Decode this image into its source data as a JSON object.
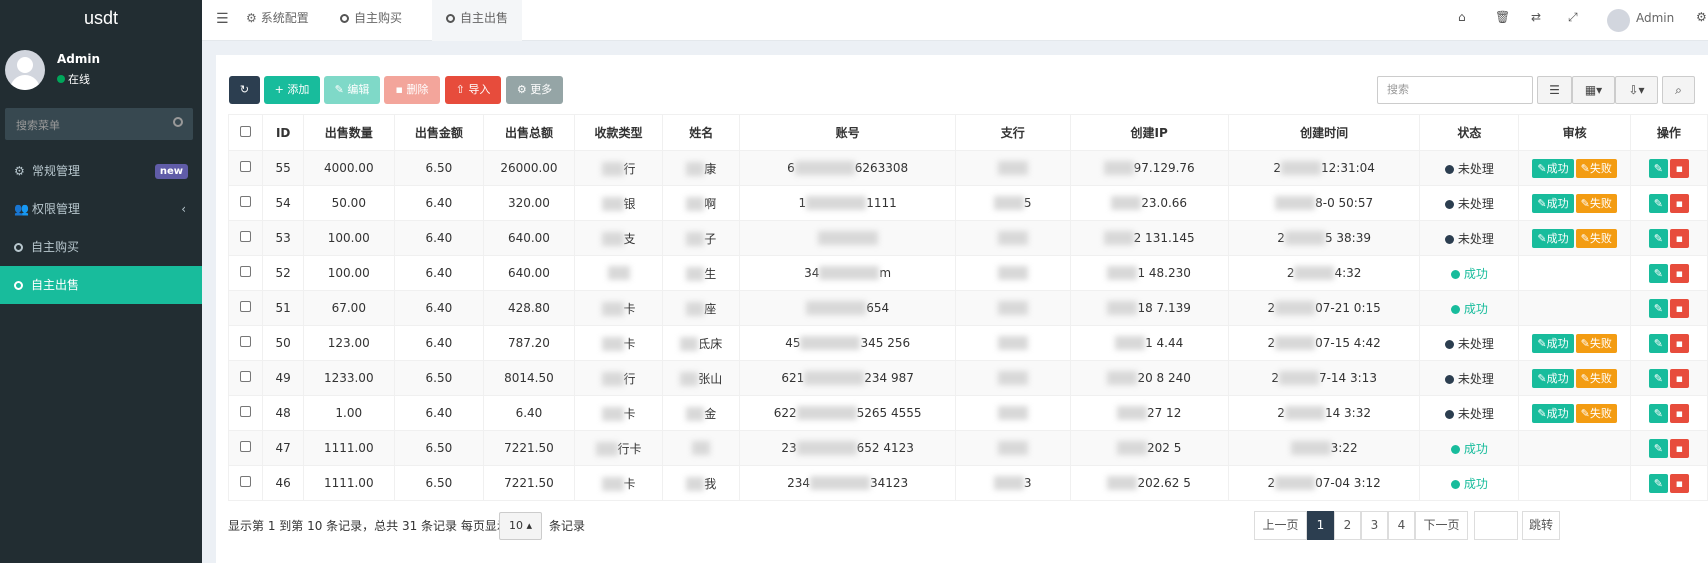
{
  "app": {
    "logo": "usdt"
  },
  "user": {
    "name": "Admin",
    "status": "在线"
  },
  "sidebar": {
    "search_placeholder": "搜索菜单",
    "items": [
      {
        "label": "常规管理",
        "icon": "cogs-icon",
        "badge": "new"
      },
      {
        "label": "权限管理",
        "icon": "group-icon",
        "arrow": "‹"
      },
      {
        "label": "自主购买",
        "icon": "circle-icon"
      },
      {
        "label": "自主出售",
        "icon": "circle-icon",
        "active": true
      }
    ]
  },
  "header": {
    "tabs": [
      {
        "label": "系统配置",
        "icon": "gear-icon"
      },
      {
        "label": "自主购买",
        "icon": "circle-icon"
      },
      {
        "label": "自主出售",
        "icon": "circle-icon",
        "active": true
      }
    ],
    "user": "Admin"
  },
  "toolbar": {
    "add": "添加",
    "edit": "编辑",
    "delete": "删除",
    "import": "导入",
    "more": "更多",
    "search_placeholder": "搜索"
  },
  "table": {
    "columns": [
      "ID",
      "出售数量",
      "出售金额",
      "出售总额",
      "收款类型",
      "姓名",
      "账号",
      "支行",
      "创建IP",
      "创建时间",
      "状态",
      "审核",
      "操作"
    ],
    "rows": [
      {
        "id": "55",
        "qty": "4000.00",
        "price": "6.50",
        "total": "26000.00",
        "type": "行",
        "name": "康",
        "account": "6",
        "account2": "6263308",
        "branch": "",
        "ip": "97.129.76",
        "time_a": "2",
        "time_b": "12:31:04",
        "status": "未处理",
        "pending": true
      },
      {
        "id": "54",
        "qty": "50.00",
        "price": "6.40",
        "total": "320.00",
        "type": "银",
        "name": "啊",
        "account": "1",
        "account2": "1111",
        "branch": "5",
        "ip": "23.0.66",
        "time_a": "",
        "time_b": "8-0  50:57",
        "status": "未处理",
        "pending": true
      },
      {
        "id": "53",
        "qty": "100.00",
        "price": "6.40",
        "total": "640.00",
        "type": "支",
        "name": "子",
        "account": "",
        "account2": "",
        "branch": "",
        "ip": "2  131.145",
        "time_a": "2",
        "time_b": "5  38:39",
        "status": "未处理",
        "pending": true
      },
      {
        "id": "52",
        "qty": "100.00",
        "price": "6.40",
        "total": "640.00",
        "type": "",
        "name": "生",
        "account": "34",
        "account2": "m",
        "branch": "",
        "ip": "1  48.230",
        "time_a": "2",
        "time_b": "4:32",
        "status": "成功",
        "pending": false
      },
      {
        "id": "51",
        "qty": "67.00",
        "price": "6.40",
        "total": "428.80",
        "type": "卡",
        "name": "座",
        "account": "",
        "account2": "654",
        "branch": "",
        "ip": "18  7.139",
        "time_a": "2",
        "time_b": "07-21  0:15",
        "status": "成功",
        "pending": false
      },
      {
        "id": "50",
        "qty": "123.00",
        "price": "6.40",
        "total": "787.20",
        "type": "卡",
        "name": "氐床",
        "account": "45",
        "account2": "345  256",
        "branch": "",
        "ip": "1  4.44",
        "time_a": "2",
        "time_b": "07-15  4:42",
        "status": "未处理",
        "pending": true
      },
      {
        "id": "49",
        "qty": "1233.00",
        "price": "6.50",
        "total": "8014.50",
        "type": "行",
        "name": "张山",
        "account": "621",
        "account2": "234  987",
        "branch": "",
        "ip": "20  8  240",
        "time_a": "2",
        "time_b": "7-14  3:13",
        "status": "未处理",
        "pending": true
      },
      {
        "id": "48",
        "qty": "1.00",
        "price": "6.40",
        "total": "6.40",
        "type": "卡",
        "name": "金",
        "account": "622",
        "account2": "5265  4555",
        "branch": "",
        "ip": "27  12",
        "time_a": "2",
        "time_b": "14  3:32",
        "status": "未处理",
        "pending": true
      },
      {
        "id": "47",
        "qty": "1111.00",
        "price": "6.50",
        "total": "7221.50",
        "type": "行卡",
        "name": "",
        "account": "23",
        "account2": "652  4123",
        "branch": "",
        "ip": "202  5",
        "time_a": "",
        "time_b": "3:22",
        "status": "成功",
        "pending": false
      },
      {
        "id": "46",
        "qty": "1111.00",
        "price": "6.50",
        "total": "7221.50",
        "type": "卡",
        "name": "我",
        "account": "234",
        "account2": "34123",
        "branch": "3",
        "ip": "202.62  5",
        "time_a": "2",
        "time_b": "07-04  3:12",
        "status": "成功",
        "pending": false
      }
    ],
    "audit_ok": "成功",
    "audit_fail": "失败"
  },
  "footer": {
    "summary": "显示第 1 到第 10 条记录，总共 31 条记录 每页显示",
    "per_page": "10",
    "suffix": "条记录"
  },
  "pagination": {
    "prev": "上一页",
    "pages": [
      "1",
      "2",
      "3",
      "4"
    ],
    "next": "下一页",
    "jump": "跳转"
  }
}
